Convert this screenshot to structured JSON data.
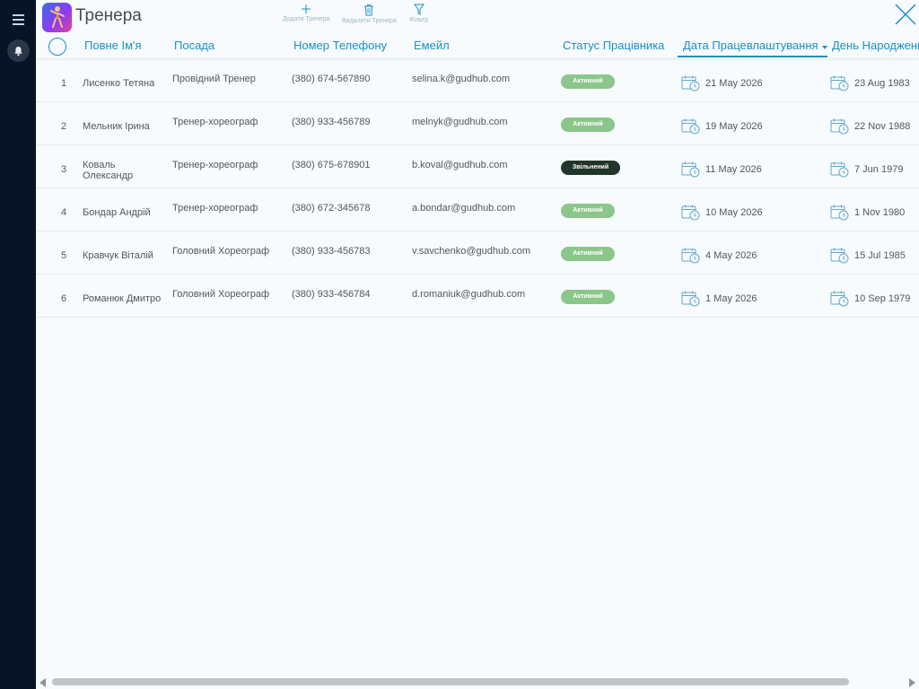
{
  "app": {
    "title": "Тренера",
    "accent_color": "#1b8ec6"
  },
  "toolbar": {
    "add_label": "Додати Тренера",
    "delete_label": "Видалити Тренера",
    "filter_label": "Фільтр"
  },
  "columns": {
    "name": "Повне Ім'я",
    "position": "Посада",
    "phone": "Номер Телефону",
    "email": "Емейл",
    "status": "Статус Працівника",
    "hire_date": "Дата Працевлаштування",
    "birthday": "День Народження"
  },
  "sort": {
    "column": "hire_date",
    "direction": "desc"
  },
  "rows": [
    {
      "num": "1",
      "name": "Лисенко Тетяна",
      "position": "Провідний Тренер",
      "phone": "(380) 674-567890",
      "email": "selina.k@gudhub.com",
      "status": "Активний",
      "status_type": "active",
      "hire_date": "21 May 2026",
      "birthday": "23 Aug 1983"
    },
    {
      "num": "2",
      "name": "Мельник Ірина",
      "position": "Тренер-хореограф",
      "phone": "(380) 933-456789",
      "email": "melnyk@gudhub.com",
      "status": "Активний",
      "status_type": "active",
      "hire_date": "19 May 2026",
      "birthday": "22 Nov 1988"
    },
    {
      "num": "3",
      "name": "Коваль Олександр",
      "position": "Тренер-хореограф",
      "phone": "(380) 675-678901",
      "email": "b.koval@gudhub.com",
      "status": "Звільнений",
      "status_type": "fired",
      "hire_date": "11 May 2026",
      "birthday": "7 Jun 1979"
    },
    {
      "num": "4",
      "name": "Бондар Андрій",
      "position": "Тренер-хореограф",
      "phone": "(380) 672-345678",
      "email": "a.bondar@gudhub.com",
      "status": "Активний",
      "status_type": "active",
      "hire_date": "10 May 2026",
      "birthday": "1 Nov 1980"
    },
    {
      "num": "5",
      "name": "Кравчук Віталій",
      "position": "Головний Хореограф",
      "phone": "(380) 933-456783",
      "email": "v.savchenko@gudhub.com",
      "status": "Активний",
      "status_type": "active",
      "hire_date": "4 May 2026",
      "birthday": "15 Jul 1985"
    },
    {
      "num": "6",
      "name": "Романюк Дмитро",
      "position": "Головний Хореограф",
      "phone": "(380) 933-456784",
      "email": "d.romaniuk@gudhub.com",
      "status": "Активний",
      "status_type": "active",
      "hire_date": "1 May 2026",
      "birthday": "10 Sep 1979"
    }
  ],
  "status_colors": {
    "active": "#8bc68b",
    "fired": "#22352a"
  },
  "icons": {
    "menu": "hamburger-menu-icon",
    "notifications": "bell-icon",
    "add": "plus-icon",
    "delete": "trash-icon",
    "filter": "funnel-icon",
    "close": "close-x-icon",
    "date": "calendar-clock-icon",
    "app": "dancer-app-icon"
  }
}
